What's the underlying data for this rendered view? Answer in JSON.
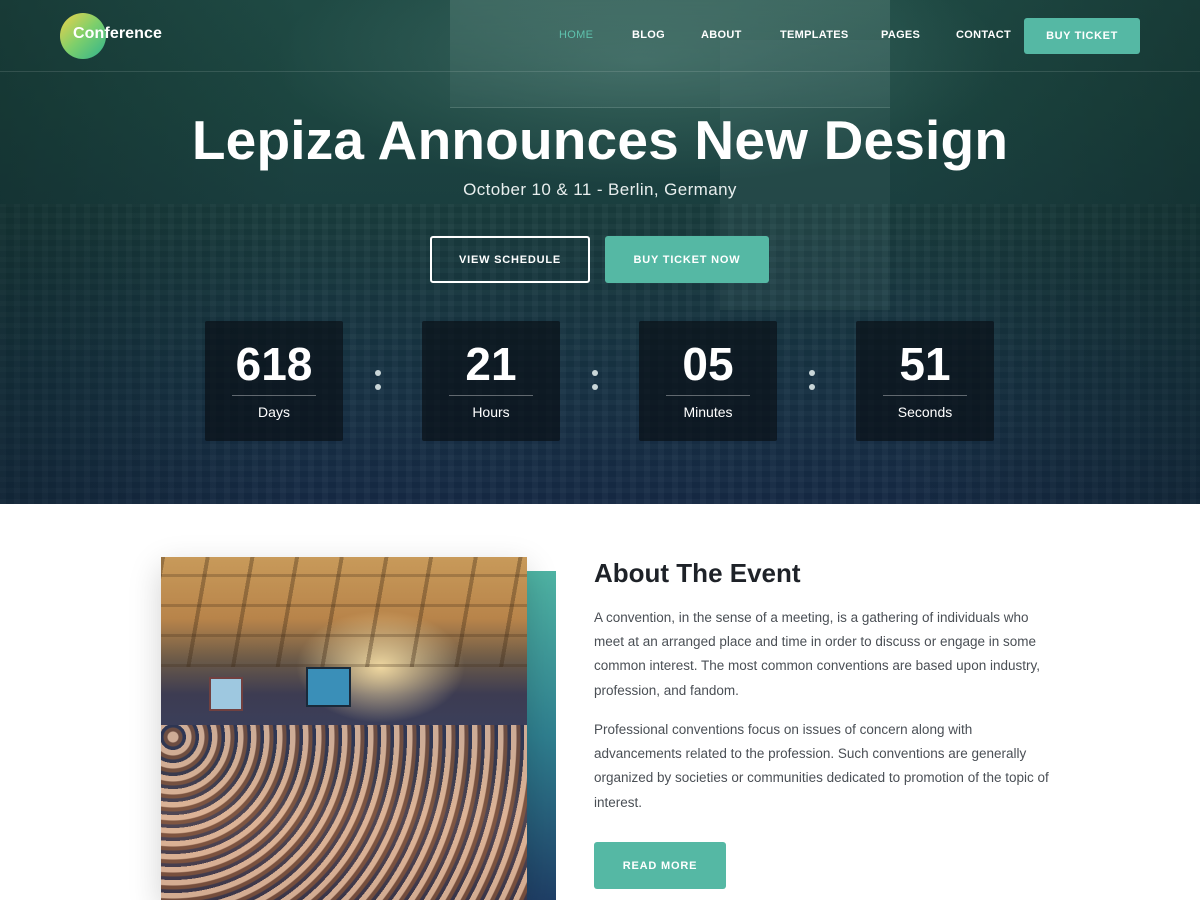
{
  "brand": {
    "name": "Conference"
  },
  "nav": {
    "items": [
      {
        "label": "HOME",
        "active": true
      },
      {
        "label": "BLOG",
        "active": false
      },
      {
        "label": "ABOUT",
        "active": false
      },
      {
        "label": "TEMPLATES",
        "active": false
      },
      {
        "label": "PAGES",
        "active": false
      },
      {
        "label": "CONTACT",
        "active": false
      }
    ],
    "cta_label": "BUY TICKET"
  },
  "hero": {
    "title": "Lepiza Announces New Design",
    "subtitle": "October 10 & 11 - Berlin, Germany",
    "primary_button": "VIEW SCHEDULE",
    "secondary_button": "BUY TICKET NOW"
  },
  "countdown": [
    {
      "value": "618",
      "label": "Days"
    },
    {
      "value": "21",
      "label": "Hours"
    },
    {
      "value": "05",
      "label": "Minutes"
    },
    {
      "value": "51",
      "label": "Seconds"
    }
  ],
  "about": {
    "title": "About The Event",
    "paragraph_1": "A convention, in the sense of a meeting, is a gathering of individuals who meet at an arranged place and time in order to discuss or engage in some common interest. The most common conventions are based upon industry, profession, and fandom.",
    "paragraph_2": "Professional conventions focus on issues of concern along with advancements related to the profession. Such conventions are generally organized by societies or communities dedicated to promotion of the topic of interest.",
    "button": "READ MORE"
  },
  "colors": {
    "accent": "#55b8a4",
    "nav_active": "#5ec2ad",
    "hero_dark": "#172b46"
  }
}
